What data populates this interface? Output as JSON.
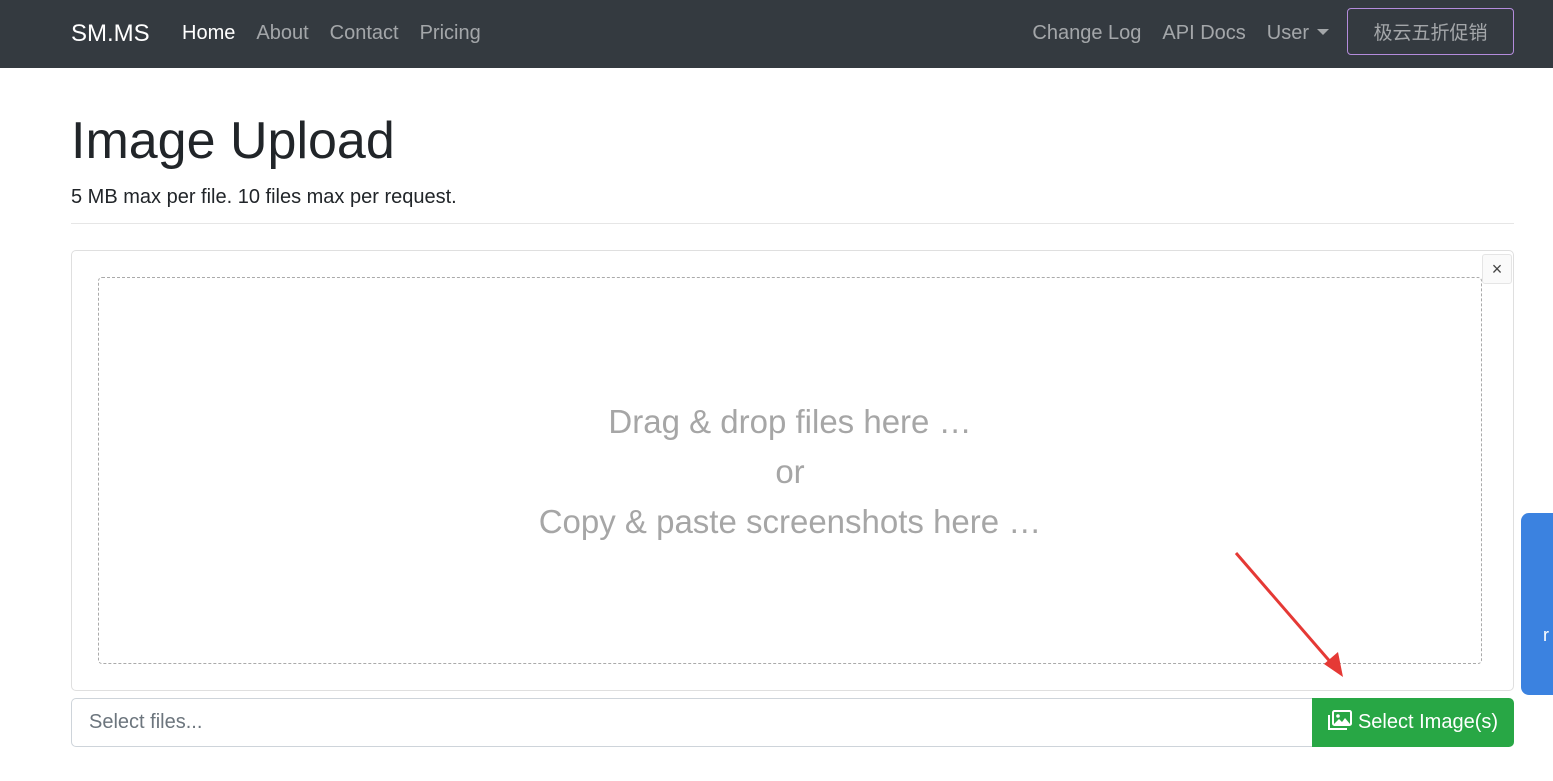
{
  "navbar": {
    "brand": "SM.MS",
    "left_links": [
      {
        "label": "Home",
        "active": true
      },
      {
        "label": "About",
        "active": false
      },
      {
        "label": "Contact",
        "active": false
      },
      {
        "label": "Pricing",
        "active": false
      }
    ],
    "right_links": [
      {
        "label": "Change Log"
      },
      {
        "label": "API Docs"
      },
      {
        "label": "User"
      }
    ],
    "promo_label": "极云五折促销"
  },
  "page": {
    "title": "Image Upload",
    "subtitle": "5 MB max per file. 10 files max per request."
  },
  "upload": {
    "close_label": "×",
    "drop_line1": "Drag & drop files here …",
    "drop_line2": "or",
    "drop_line3": "Copy & paste screenshots here …",
    "file_placeholder": "Select files...",
    "select_button": "Select Image(s)"
  },
  "side_tab": {
    "text": "r"
  },
  "colors": {
    "navbar_bg": "#343a40",
    "success": "#28a745",
    "side_tab": "#3b82e0",
    "annotation_arrow": "#e53935"
  },
  "icons": {
    "select_button_icon": "images-icon",
    "user_dropdown_icon": "caret-down-icon"
  }
}
